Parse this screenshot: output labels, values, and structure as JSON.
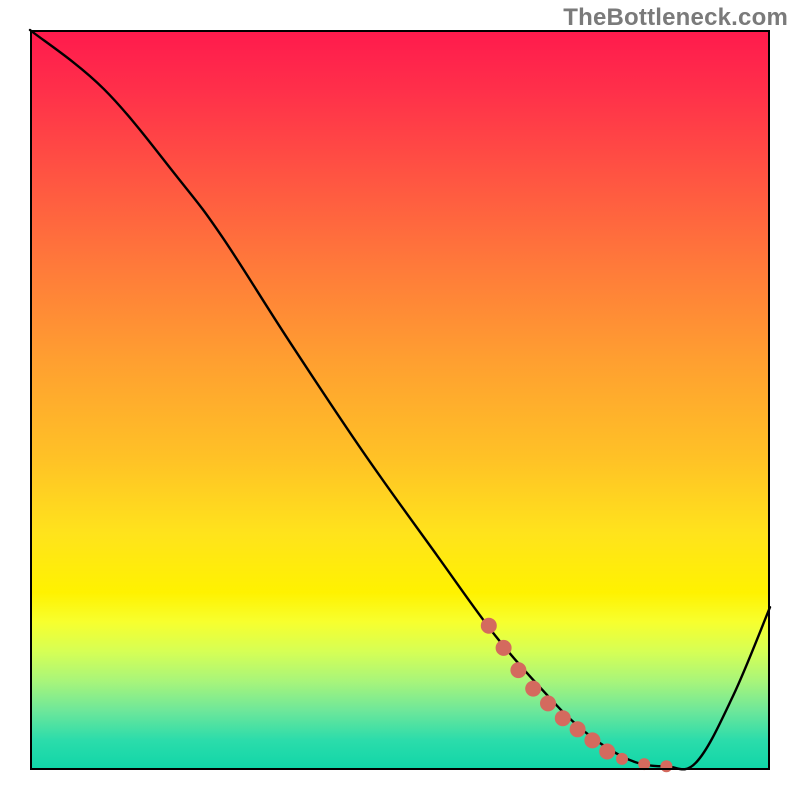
{
  "watermark": "TheBottleneck.com",
  "chart_data": {
    "type": "line",
    "title": "",
    "xlabel": "",
    "ylabel": "",
    "xlim": [
      0,
      100
    ],
    "ylim": [
      0,
      100
    ],
    "grid": false,
    "legend": false,
    "series": [
      {
        "name": "curve",
        "color": "#000000",
        "x": [
          0,
          10,
          20,
          26,
          35,
          45,
          55,
          63,
          70,
          74,
          78,
          82,
          86,
          90,
          95,
          100
        ],
        "values": [
          100,
          92,
          80,
          72,
          58,
          43,
          29,
          18,
          10,
          6,
          3,
          1,
          0.5,
          1,
          10,
          22
        ]
      }
    ],
    "highlight": {
      "name": "highlight-dots",
      "color": "#d46a5e",
      "points": [
        {
          "x": 62,
          "y": 19.5
        },
        {
          "x": 64,
          "y": 16.5
        },
        {
          "x": 66,
          "y": 13.5
        },
        {
          "x": 68,
          "y": 11.0
        },
        {
          "x": 70,
          "y": 9.0
        },
        {
          "x": 72,
          "y": 7.0
        },
        {
          "x": 74,
          "y": 5.5
        },
        {
          "x": 76,
          "y": 4.0
        },
        {
          "x": 78,
          "y": 2.5
        },
        {
          "x": 80,
          "y": 1.5
        },
        {
          "x": 83,
          "y": 0.8
        },
        {
          "x": 86,
          "y": 0.5
        }
      ]
    }
  }
}
